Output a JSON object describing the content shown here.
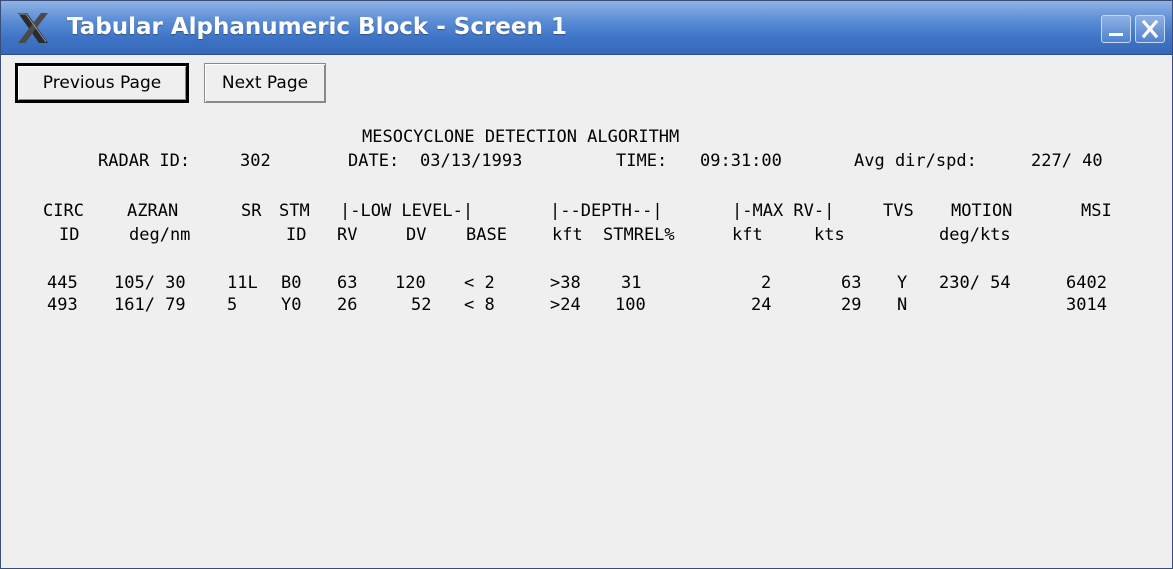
{
  "window": {
    "title": "Tabular Alphanumeric Block - Screen 1",
    "app_icon": "x-logo-icon"
  },
  "toolbar": {
    "previous_label": "Previous Page",
    "next_label": "Next Page"
  },
  "report": {
    "title": "MESOCYCLONE DETECTION ALGORITHM",
    "radar_id_label": "RADAR ID:",
    "radar_id": "302",
    "date_label": "DATE:",
    "date": "03/13/1993",
    "time_label": "TIME:",
    "time": "09:31:00",
    "avg_label": "Avg dir/spd:",
    "avg_value": "227/ 40"
  },
  "table": {
    "headers1": [
      "CIRC",
      "AZRAN",
      "SR",
      "STM",
      "|-LOW LEVEL-|",
      "|--DEPTH--|",
      "|-MAX RV-|",
      "TVS",
      "MOTION",
      "MSI"
    ],
    "headers2": [
      "ID",
      "deg/nm",
      "ID",
      "RV",
      "DV",
      "BASE",
      "kft",
      "STMREL%",
      "kft",
      "kts",
      "deg/kts"
    ],
    "rows": [
      [
        "445",
        "105/ 30",
        "11L",
        "B0",
        "63",
        "120",
        "< 2",
        ">38",
        "31",
        "2",
        "63",
        "Y",
        "230/ 54",
        "6402"
      ],
      [
        "493",
        "161/ 79",
        "5",
        "Y0",
        "26",
        "52",
        "< 8",
        ">24",
        "100",
        "24",
        "29",
        "N",
        "",
        "3014"
      ]
    ]
  },
  "colors": {
    "titlebar": "#3e73c6",
    "background": "#efefef"
  }
}
